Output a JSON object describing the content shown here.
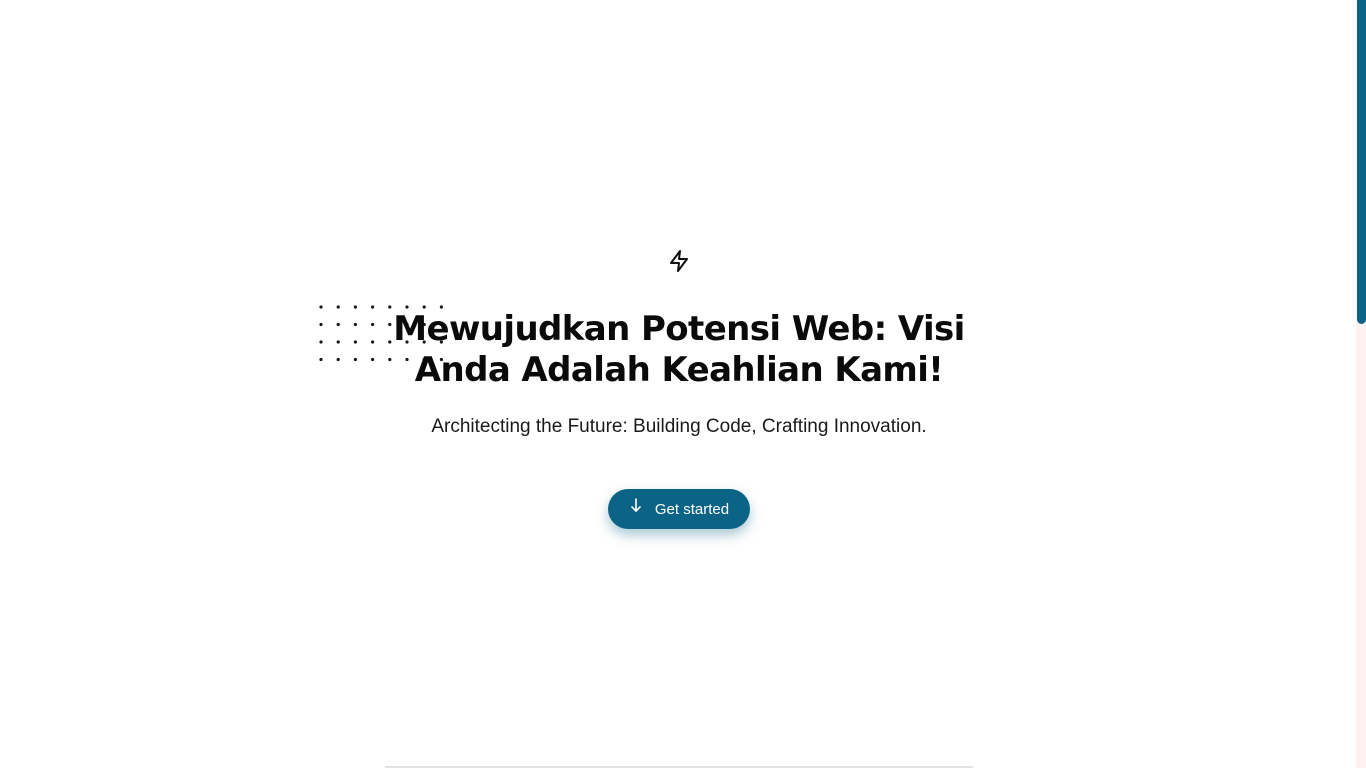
{
  "hero": {
    "title": "Mewujudkan Potensi Web: Visi Anda Adalah Keahlian Kami!",
    "subtitle": "Architecting the Future: Building Code, Crafting Innovation.",
    "cta_label": "Get started",
    "top_icon": "lightning-bolt-icon",
    "cta_icon": "arrow-down-icon"
  },
  "colors": {
    "accent": "#0b6485",
    "text": "#0a0a0a",
    "background": "#ffffff",
    "scrollbar_track": "#fdf1f1"
  }
}
